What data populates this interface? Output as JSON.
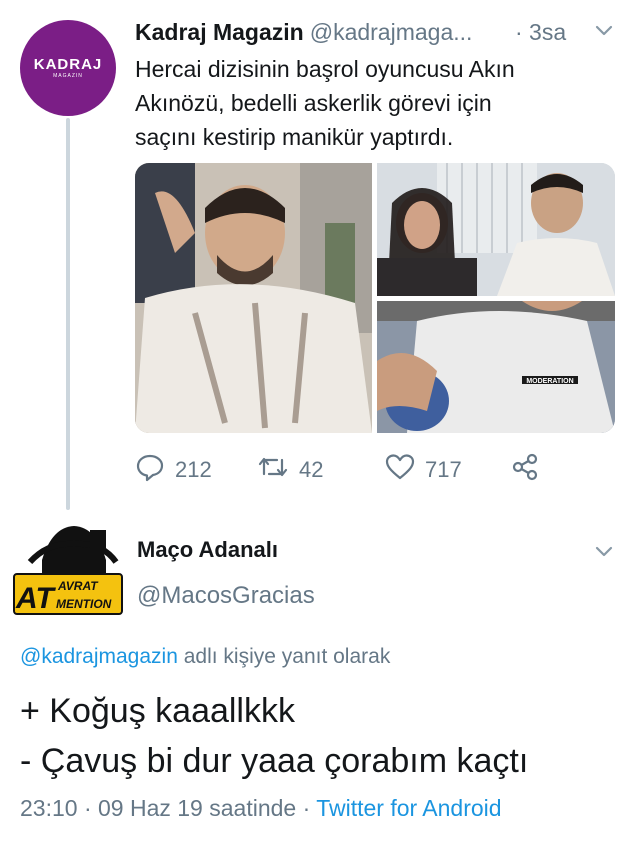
{
  "tweet1": {
    "name": "Kadraj Magazin",
    "handle": "@kadrajmaga...",
    "time": "· 3sa",
    "text_lines": [
      "Hercai dizisinin başrol oyuncusu Akın",
      "Akınözü, bedelli askerlik görevi için",
      "saçını kestirip manikür yaptırdı."
    ],
    "avatar_logo": "KADRAJ",
    "avatar_sub": "MAGAZIN",
    "shirt_text": "MODERATION",
    "replies": "212",
    "retweets": "42",
    "likes": "717"
  },
  "tweet2": {
    "name": "Maço Adanalı",
    "handle": "@MacosGracias",
    "avatar_text_big": "AT",
    "avatar_text_1": "AVRAT",
    "avatar_text_2": "MENTION",
    "reply_handle": "@kadrajmagazin",
    "reply_suffix": " adlı kişiye yanıt olarak",
    "text_lines": [
      "+ Koğuş kaaallkkk",
      "- Çavuş bi dur yaaa çorabım kaçtı"
    ],
    "timestamp": "23:10 · 09 Haz 19 saatinde · ",
    "source": "Twitter for Android"
  },
  "colors": {
    "link": "#1b95e0",
    "secondary": "#657786",
    "avatar_bg": "#7b1e86",
    "thread": "#ccd6dd"
  },
  "icons": [
    "reply-icon",
    "retweet-icon",
    "like-icon",
    "share-icon",
    "chevron-down-icon"
  ]
}
